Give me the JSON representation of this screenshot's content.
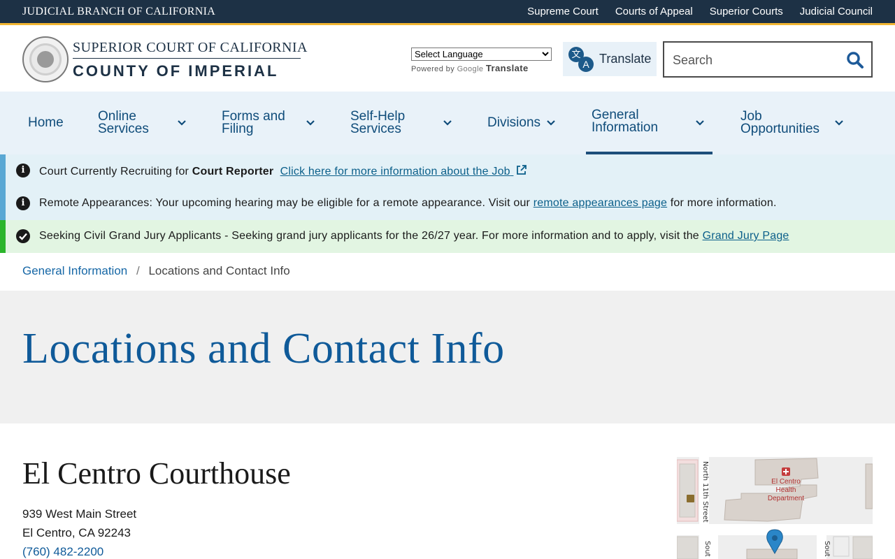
{
  "topbar": {
    "brand": "JUDICIAL BRANCH OF CALIFORNIA",
    "links": [
      "Supreme Court",
      "Courts of Appeal",
      "Superior Courts",
      "Judicial Council"
    ]
  },
  "header": {
    "court_line1": "SUPERIOR COURT OF CALIFORNIA",
    "court_line2": "COUNTY OF IMPERIAL",
    "language_select": "Select Language",
    "powered_by": "Powered by",
    "google": "Google",
    "translate_word": "Translate",
    "translate_button": "Translate",
    "search_placeholder": "Search"
  },
  "nav": {
    "items": [
      {
        "label": "Home",
        "dropdown": false
      },
      {
        "label": "Online Services",
        "dropdown": true
      },
      {
        "label": "Forms and Filing",
        "dropdown": true
      },
      {
        "label": "Self-Help Services",
        "dropdown": true
      },
      {
        "label": "Divisions",
        "dropdown": true
      },
      {
        "label": "General Information",
        "dropdown": true,
        "active": true
      },
      {
        "label": "Job Opportunities",
        "dropdown": true
      }
    ]
  },
  "alerts": [
    {
      "prefix": "Court Currently Recruiting for ",
      "bold": "Court Reporter",
      "link": "Click here for more information about the Job",
      "style": "info"
    },
    {
      "prefix": "Remote Appearances: Your upcoming hearing may be eligible for a remote appearance. Visit our ",
      "link": "remote appearances page",
      "suffix": " for more information.",
      "style": "info"
    },
    {
      "prefix": "Seeking Civil Grand Jury Applicants - Seeking grand jury applicants for the 26/27 year. For more information and to apply, visit the ",
      "link": "Grand Jury Page",
      "style": "success"
    }
  ],
  "breadcrumb": {
    "parent": "General Information",
    "separator": "/",
    "current": "Locations and Contact Info"
  },
  "hero": {
    "title": "Locations and Contact Info"
  },
  "location": {
    "name": "El Centro Courthouse",
    "street": "939 West Main Street",
    "city": "El Centro, CA 92243",
    "phone": "(760) 482-2200"
  },
  "map": {
    "street_label_1": "North 11th Street",
    "poi_label": "El Centro Health Department",
    "street_label_2": "Sout",
    "street_label_3": "Sout"
  },
  "colors": {
    "topbar_bg": "#1d3145",
    "accent_gold": "#f2b632",
    "nav_bg": "#e9f2f9",
    "link_blue": "#0f5a99",
    "info_alert_bg": "#e3f1f7",
    "success_alert_bg": "#e2f5e2"
  }
}
